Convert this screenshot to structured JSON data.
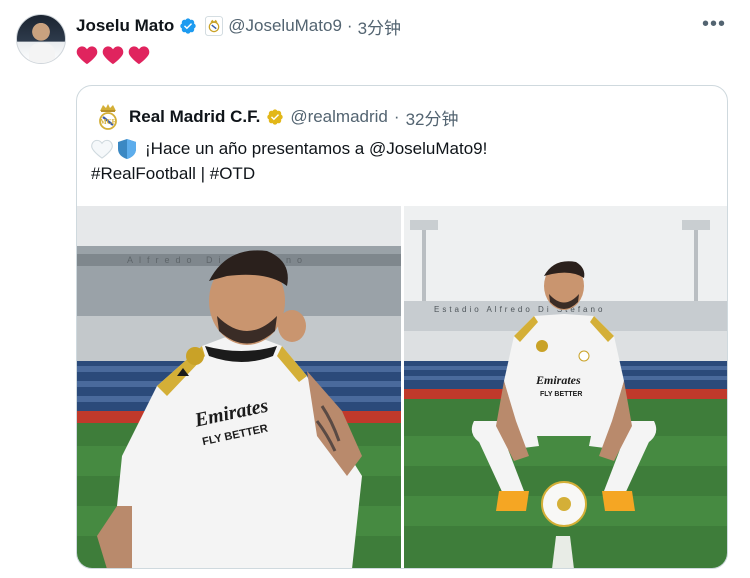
{
  "tweet": {
    "author_name": "Joselu Mato",
    "handle": "@JoseluMato9",
    "separator": "·",
    "time": "3分钟",
    "more_label": "•••",
    "body_emoji": [
      "red-heart",
      "red-heart",
      "red-heart"
    ]
  },
  "quoted": {
    "author_name": "Real Madrid C.F.",
    "handle": "@realmadrid",
    "separator": "·",
    "time": "32分钟",
    "text_line1": "¡Hace un año presentamos a @JoseluMato9!",
    "text_line2": "#RealFootball | #OTD",
    "line1_emoji": [
      "white-heart",
      "blue-shield"
    ]
  },
  "photos": {
    "photo1": {
      "stadium_sign": "Alfredo Di Stefano",
      "shirt_sponsor": "Emirates",
      "shirt_tagline": "FLY BETTER"
    },
    "photo2": {
      "stadium_sign": "Estadio Alfredo Di Stefano",
      "shirt_sponsor": "Emirates",
      "shirt_tagline": "FLY BETTER"
    }
  },
  "colors": {
    "verified_blue": "#1d9bf0",
    "verified_gold": "#e2b719",
    "heart_red": "#e0245e",
    "text_secondary": "#536471",
    "border": "#cfd9de"
  }
}
